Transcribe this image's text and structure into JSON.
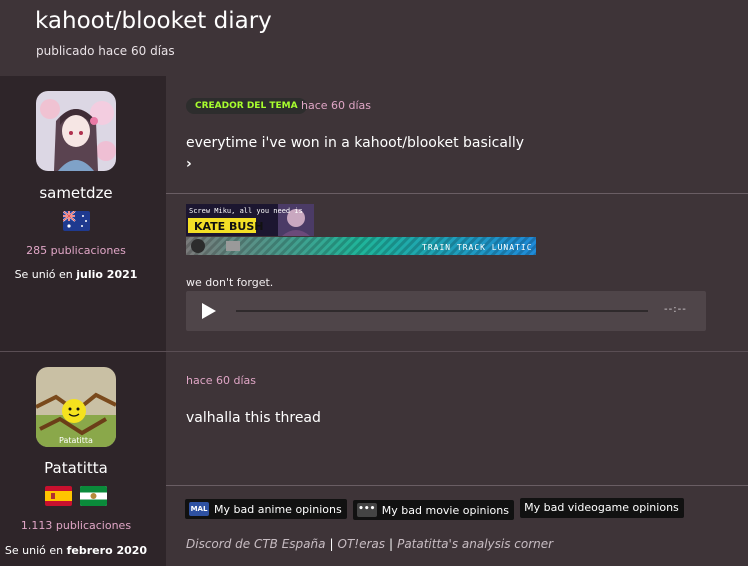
{
  "header": {
    "title": "kahoot/blooket diary",
    "subtitle": "publicado hace 60 días"
  },
  "posts": [
    {
      "user": {
        "name": "sametdze",
        "flags": [
          "australia-flag"
        ],
        "posts_count": "285 publicaciones",
        "joined_prefix": "Se unió en",
        "joined_date": "julio 2021"
      },
      "badge": "CREADOR DEL TEMA",
      "time": "hace 60 días",
      "body": "everytime i've won in a kahoot/blooket basically",
      "signature": {
        "banner_top": "Screw Miku, all you need is",
        "banner_name": "KATE BUSH",
        "banner_bar": "TRAIN TRACK LUNATIC",
        "caption": "we don't forget.",
        "player_time": "--:--"
      }
    },
    {
      "user": {
        "name": "Patatitta",
        "avatar_caption": "Patatitta",
        "flags": [
          "spain-flag",
          "andalusia-flag"
        ],
        "posts_count": "1.113 publicaciones",
        "joined_prefix": "Se unió en",
        "joined_date": "febrero 2020"
      },
      "time": "hace 60 días",
      "body": "valhalla this thread",
      "signature": {
        "pills": [
          {
            "icon": "MAL",
            "label": "My bad anime opinions"
          },
          {
            "icon": "•••",
            "label": "My bad movie opinions"
          },
          {
            "icon": "",
            "label": "My bad videogame opinions"
          }
        ],
        "links": [
          "Discord de CTB España",
          "OT!eras",
          "Patatitta's analysis corner"
        ]
      }
    }
  ],
  "colors": {
    "background": "#3e3438",
    "sidebar": "#2e2529",
    "accent_pink": "#e0a6c6",
    "badge_green": "#a8ff2e"
  }
}
